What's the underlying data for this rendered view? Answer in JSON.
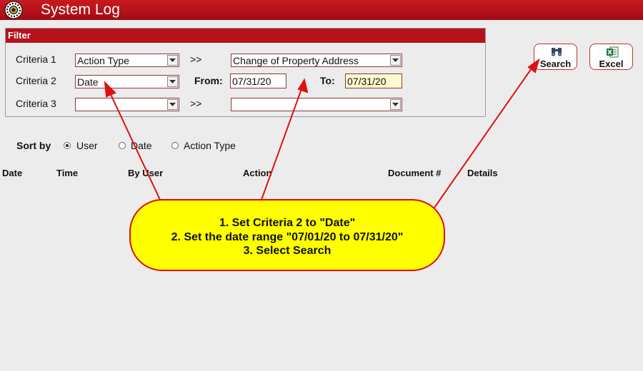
{
  "app": {
    "title": "System Log"
  },
  "filter": {
    "header": "Filter",
    "criteria1_label": "Criteria 1",
    "criteria2_label": "Criteria 2",
    "criteria3_label": "Criteria 3",
    "criteria1_value": "Action Type",
    "criteria1_sep": ">>",
    "criteria1_detail": "Change of Property Address",
    "criteria2_value": "Date",
    "from_label": "From:",
    "from_value": "07/31/20",
    "to_label": "To:",
    "to_value": "07/31/20",
    "criteria3_value": "",
    "criteria3_sep": ">>",
    "criteria3_detail": ""
  },
  "buttons": {
    "search_label": "Search",
    "excel_label": "Excel"
  },
  "sort": {
    "label": "Sort by",
    "options": [
      "User",
      "Date",
      "Action Type"
    ],
    "selected": "User"
  },
  "columns": [
    "Date",
    "Time",
    "By User",
    "Action",
    "Document #",
    "Details"
  ],
  "callout": {
    "line1": "1. Set Criteria 2 to \"Date\"",
    "line2": "2. Set the date range  \"07/01/20 to 07/31/20\"",
    "line3": "3. Select Search"
  },
  "colors": {
    "titlebar": "#b5101a",
    "callout_bg": "#ffff00",
    "arrow": "#dd1111"
  }
}
